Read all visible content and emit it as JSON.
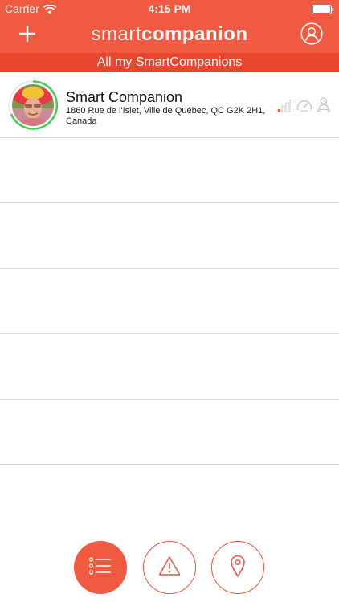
{
  "status_bar": {
    "carrier": "Carrier",
    "time": "4:15 PM",
    "wifi_icon": "wifi-icon",
    "battery_icon": "battery-icon"
  },
  "header": {
    "brand_light": "smart",
    "brand_bold": "companion",
    "add_icon": "plus-icon",
    "profile_icon": "user-circle-icon",
    "background": "#f05a40"
  },
  "section": {
    "title": "All my SmartCompanions",
    "background": "#e7472e"
  },
  "companions": [
    {
      "name": "Smart Companion",
      "address": "1860 Rue de l'Islet, Ville de Québec, QC G2K 2H1, Canada",
      "avatar_ring_color": "#3fcf4f",
      "signal_icon": "signal-bars-icon",
      "signal_color": "#e9563d",
      "speed_icon": "speedometer-icon",
      "location_icon": "location-person-icon"
    }
  ],
  "tabs": [
    {
      "icon": "list-icon",
      "active": true
    },
    {
      "icon": "warning-icon",
      "active": false
    },
    {
      "icon": "map-pin-icon",
      "active": false
    }
  ],
  "accent_color": "#f05a40"
}
